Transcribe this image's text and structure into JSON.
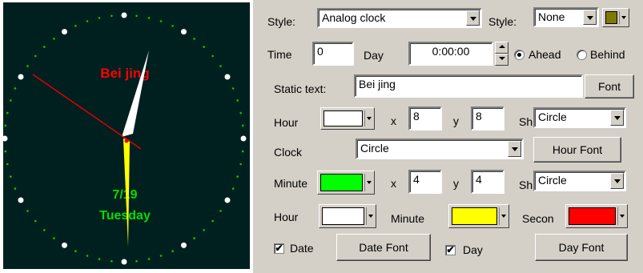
{
  "clock": {
    "static_text": "Bei jing",
    "date": "7/19",
    "day": "Tuesday",
    "static_text_color": "#ff0000",
    "date_color": "#00dd00",
    "face_color": "#002020"
  },
  "settings": {
    "style_label": "Style:",
    "style_value": "Analog clock",
    "style2_label": "Style:",
    "style2_value": "None",
    "style2_color": "#7f7a00",
    "time_label": "Time",
    "time_value": "0",
    "day_label": "Day",
    "day_value": "0:00:00",
    "ahead_label": "Ahead",
    "behind_label": "Behind",
    "static_text_label": "Static text:",
    "static_text_value": "Bei jing",
    "font_button": "Font",
    "hour_label": "Hour",
    "hour_color": "#ffffff",
    "hour_x_label": "x",
    "hour_x": "8",
    "hour_y_label": "y",
    "hour_y": "8",
    "hour_sh_label": "Sh",
    "hour_shape": "Circle",
    "clock_label": "Clock",
    "clock_shape": "Circle",
    "hour_font_button": "Hour Font",
    "minute_label": "Minute",
    "minute_color": "#00ff00",
    "minute_x_label": "x",
    "minute_x": "4",
    "minute_y_label": "y",
    "minute_y": "4",
    "minute_sh_label": "Sh",
    "minute_shape": "Circle",
    "hand_hour_label": "Hour",
    "hand_hour_color": "#ffffff",
    "hand_minute_label": "Minute",
    "hand_minute_color": "#ffff00",
    "hand_second_label": "Secon",
    "hand_second_color": "#ff0000",
    "date_check_label": "Date",
    "date_font_button": "Date Font",
    "day_check_label": "Day",
    "day_font_button": "Day Font",
    "check_mark": "✔"
  }
}
